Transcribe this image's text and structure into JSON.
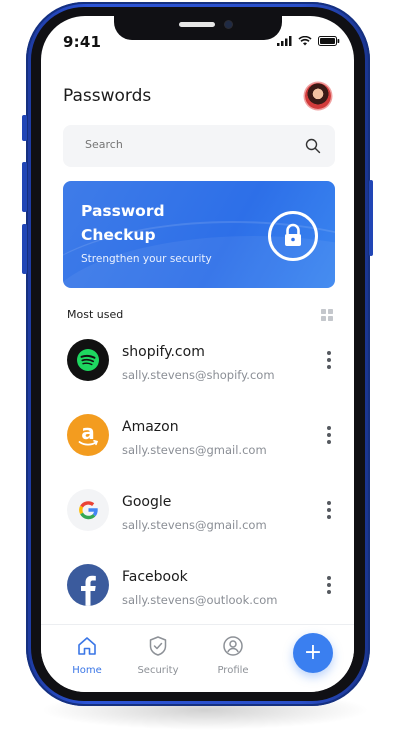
{
  "status": {
    "time": "9:41"
  },
  "header": {
    "title": "Passwords"
  },
  "search": {
    "placeholder": "Search"
  },
  "checkup": {
    "title": "Password Checkup",
    "subtitle": "Strengthen your security"
  },
  "section": {
    "label": "Most used"
  },
  "passwords": [
    {
      "site": "shopify.com",
      "email": "sally.stevens@shopify.com",
      "icon": "spotify-logo-icon"
    },
    {
      "site": "Amazon",
      "email": "sally.stevens@gmail.com",
      "icon": "amazon-logo-icon"
    },
    {
      "site": "Google",
      "email": "sally.stevens@gmail.com",
      "icon": "google-logo-icon"
    },
    {
      "site": "Facebook",
      "email": "sally.stevens@outlook.com",
      "icon": "facebook-logo-icon"
    }
  ],
  "nav": {
    "tabs": [
      {
        "label": "Home",
        "icon": "home-icon",
        "active": true
      },
      {
        "label": "Security",
        "icon": "shield-icon",
        "active": false
      },
      {
        "label": "Profile",
        "icon": "user-icon",
        "active": false
      }
    ],
    "fab_symbol": "+"
  },
  "colors": {
    "accent": "#3a7ff0",
    "card_blue": "#2d6fe8",
    "phone_frame": "#2a4fc9"
  }
}
